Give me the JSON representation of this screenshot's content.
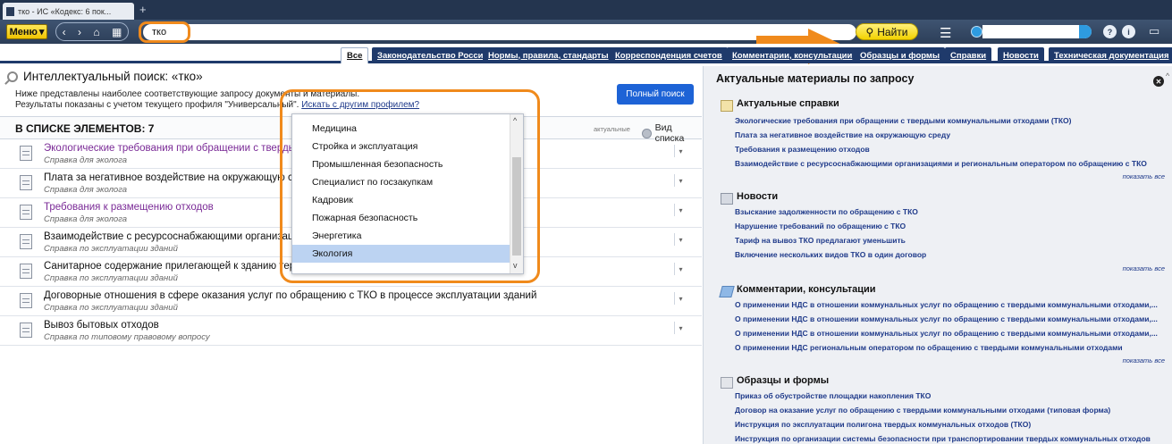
{
  "browser": {
    "tab_title": "тко - ИС «Кодекс: 6 пок...",
    "new_tab": "+"
  },
  "toolbar": {
    "menu_label": "Меню",
    "menu_arrow": "▾",
    "nav_back": "‹",
    "nav_forward": "›",
    "nav_home": "⌂",
    "nav_grid": "▦",
    "search_value": "тко",
    "find_label": "Найти",
    "find_icon": "⚲",
    "hamburger": "☰",
    "help": "?",
    "info": "i",
    "chat": "▭"
  },
  "category_tabs": [
    "Все",
    "Законодательство России",
    "Нормы, правила, стандарты",
    "Корреспонденция счетов",
    "Комментарии, консультации",
    "Образцы и формы",
    "Справки",
    "Новости",
    "Техническая документация"
  ],
  "left": {
    "title": "Интеллектуальный поиск: «тко»",
    "desc_line1": "Ниже представлены наиболее соответствующие запросу документы и материалы.",
    "desc_line2_prefix": "Результаты показаны с учетом текущего профиля \"Универсальный\". ",
    "other_profile_link": "Искать с другим профилем?",
    "full_search_label": "Полный поиск",
    "list_count": "В СПИСКЕ ЭЛЕМЕНТОВ: 7",
    "actual_label": "актуальные",
    "view_mode_label": "Вид списка",
    "row_menu_glyph": "▾",
    "documents": [
      {
        "title": "Экологические требования при обращении с твердыми коммунальными отходами (ТКО)",
        "subtitle": "Справка для эколога"
      },
      {
        "title": "Плата за негативное воздействие на окружающую среду",
        "subtitle": "Справка для эколога"
      },
      {
        "title": "Требования к размещению отходов",
        "subtitle": "Справка для эколога"
      },
      {
        "title": "Взаимодействие с ресурсоснабжающими организациями и региональным оператором",
        "subtitle": "Справка по эксплуатации зданий"
      },
      {
        "title": "Санитарное содержание прилегающей к зданию территории (уборка и сбор ТКО)",
        "subtitle": "Справка по эксплуатации зданий"
      },
      {
        "title": "Договорные отношения в сфере оказания услуг по обращению с ТКО в процессе эксплуатации зданий",
        "subtitle": "Справка по эксплуатации зданий"
      },
      {
        "title": "Вывоз бытовых отходов",
        "subtitle": "Справка по типовому правовому вопросу"
      }
    ]
  },
  "dropdown": {
    "options": [
      "Медицина",
      "Стройка и эксплуатация",
      "Промышленная безопасность",
      "Специалист по госзакупкам",
      "Кадровик",
      "Пожарная безопасность",
      "Энергетика",
      "Экология"
    ],
    "selected": "Экология",
    "scroll_up": "^",
    "scroll_down": "v"
  },
  "right": {
    "title": "Актуальные материалы по запросу",
    "close_glyph": "✕",
    "scroll_up": "^",
    "show_all": "показать все",
    "sections": [
      {
        "title": "Актуальные справки",
        "links": [
          "Экологические требования при обращении с твердыми коммунальными отходами (ТКО)",
          "Плата за негативное воздействие на окружающую среду",
          "Требования к размещению отходов",
          "Взаимодействие с ресурсоснабжающими организациями и региональным оператором по обращению с ТКО"
        ]
      },
      {
        "title": "Новости",
        "links": [
          "Взыскание задолженности по обращению с ТКО",
          "Нарушение требований по обращению с ТКО",
          "Тариф на вывоз ТКО предлагают уменьшить",
          "Включение нескольких видов ТКО в один договор"
        ]
      },
      {
        "title": "Комментарии, консультации",
        "links": [
          "О применении НДС в отношении коммунальных услуг по обращению с твердыми коммунальными отходами,...",
          "О применении НДС в отношении коммунальных услуг по обращению с твердыми коммунальными отходами,...",
          "О применении НДС в отношении коммунальных услуг по обращению с твердыми коммунальными отходами,...",
          "О применении НДС региональным оператором по обращению с твердыми коммунальными отходами"
        ]
      },
      {
        "title": "Образцы и формы",
        "links": [
          "Приказ об обустройстве площадки накопления ТКО",
          "Договор на оказание услуг по обращению с твердыми коммунальными отходами (типовая форма)",
          "Инструкция по эксплуатации полигона твердых коммунальных отходов (ТКО)",
          "Инструкция по организации системы безопасности при транспортировании твердых коммунальных отходов"
        ]
      }
    ]
  },
  "colors": {
    "accent": "#1f3a6b",
    "highlight": "#f08a1c",
    "link": "#1f3a8a",
    "visited": "#7a2a96",
    "button": "#1d63d6"
  }
}
